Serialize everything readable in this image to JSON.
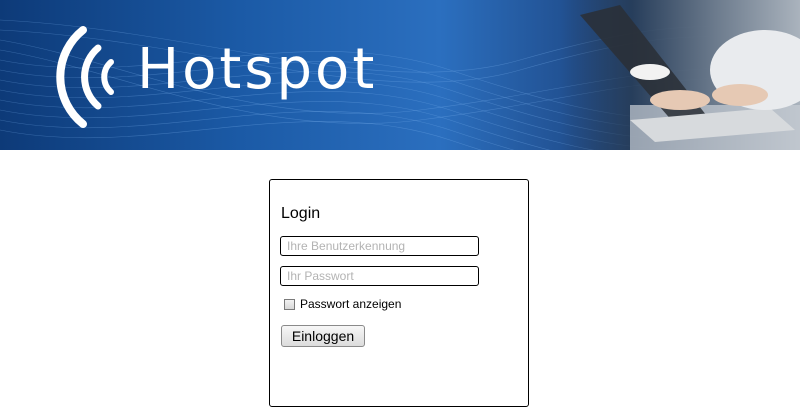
{
  "header": {
    "logo_text": "Hotspot",
    "logo_icon": "wifi-waves-icon"
  },
  "login": {
    "title": "Login",
    "username_placeholder": "Ihre Benutzerkennung",
    "username_value": "",
    "password_placeholder": "Ihr Passwort",
    "password_value": "",
    "show_password_label": "Passwort anzeigen",
    "show_password_checked": false,
    "submit_label": "Einloggen"
  }
}
